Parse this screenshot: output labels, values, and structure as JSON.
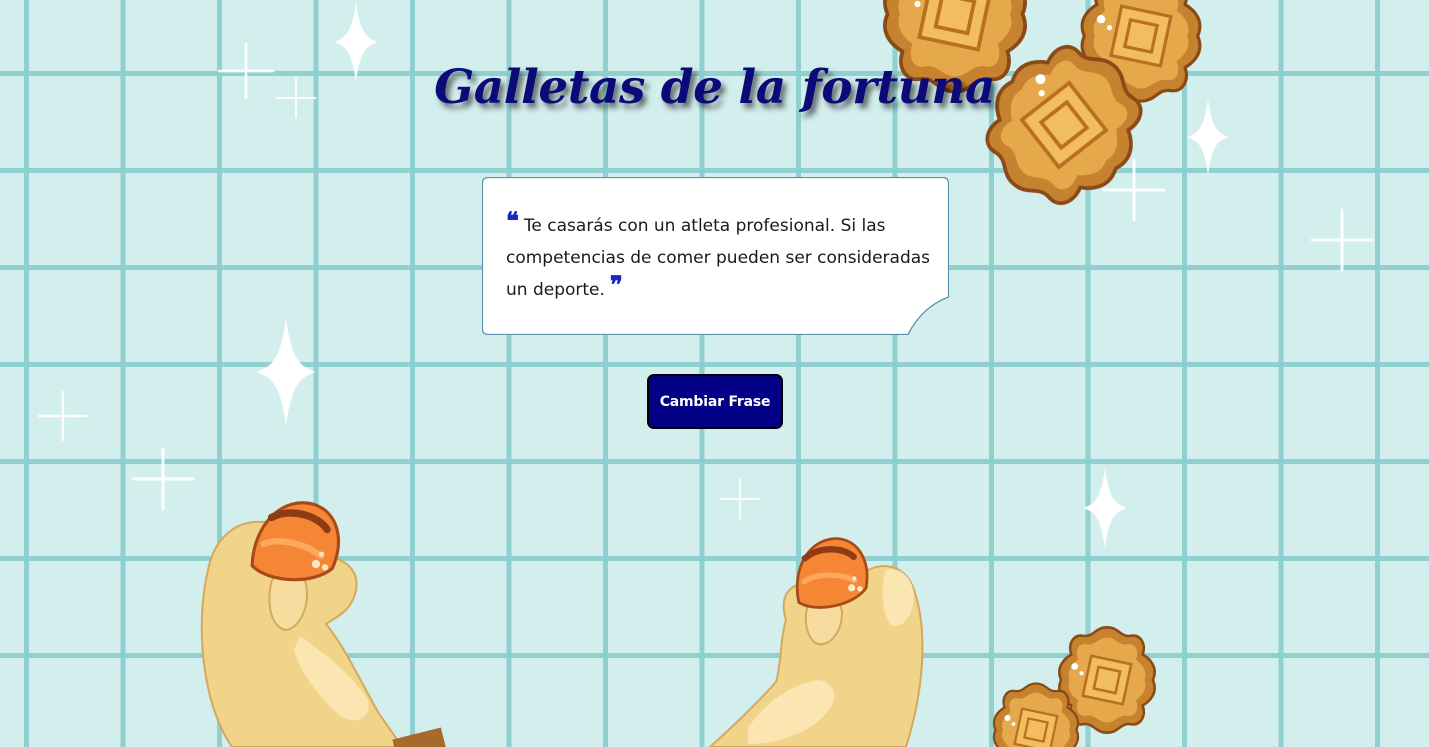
{
  "page": {
    "title": "Galletas de la fortuna"
  },
  "quote": {
    "open_mark": "❝",
    "text": "Te casarás con un atleta profesional. Si las competencias de comer pueden ser consideradas un deporte.",
    "close_mark": "❞"
  },
  "actions": {
    "change_label": "Cambiar Frase"
  },
  "colors": {
    "background": "#d2eeed",
    "grid_line": "#8ccece",
    "title": "#0c0a78",
    "button": "#020084",
    "quote_marks": "#1b24c7"
  },
  "decorations": {
    "icons": [
      "sparkle-icon",
      "mooncake-icon",
      "hand-icon",
      "fortune-cookie-icon"
    ]
  }
}
